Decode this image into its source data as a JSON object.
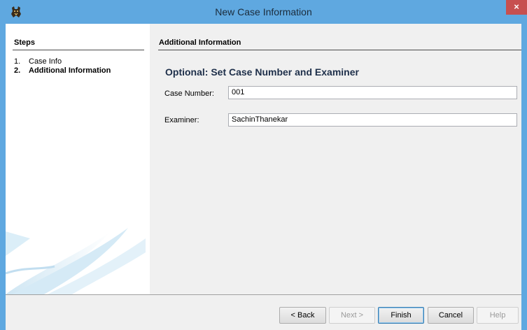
{
  "window": {
    "title": "New Case Information",
    "close_glyph": "×",
    "app_icon": "autopsy-dog-icon"
  },
  "steps": {
    "title": "Steps",
    "items": [
      {
        "num": "1.",
        "label": "Case Info"
      },
      {
        "num": "2.",
        "label": "Additional Information"
      }
    ]
  },
  "panel": {
    "title": "Additional Information",
    "heading": "Optional: Set Case Number and Examiner",
    "case_number_label": "Case Number:",
    "case_number_value": "001",
    "examiner_label": "Examiner:",
    "examiner_value": "SachinThanekar"
  },
  "buttons": {
    "back": "< Back",
    "next": "Next >",
    "finish": "Finish",
    "cancel": "Cancel",
    "help": "Help"
  },
  "colors": {
    "titlebar": "#5fa8e0",
    "close": "#c75050",
    "heading": "#1e2f4a"
  }
}
